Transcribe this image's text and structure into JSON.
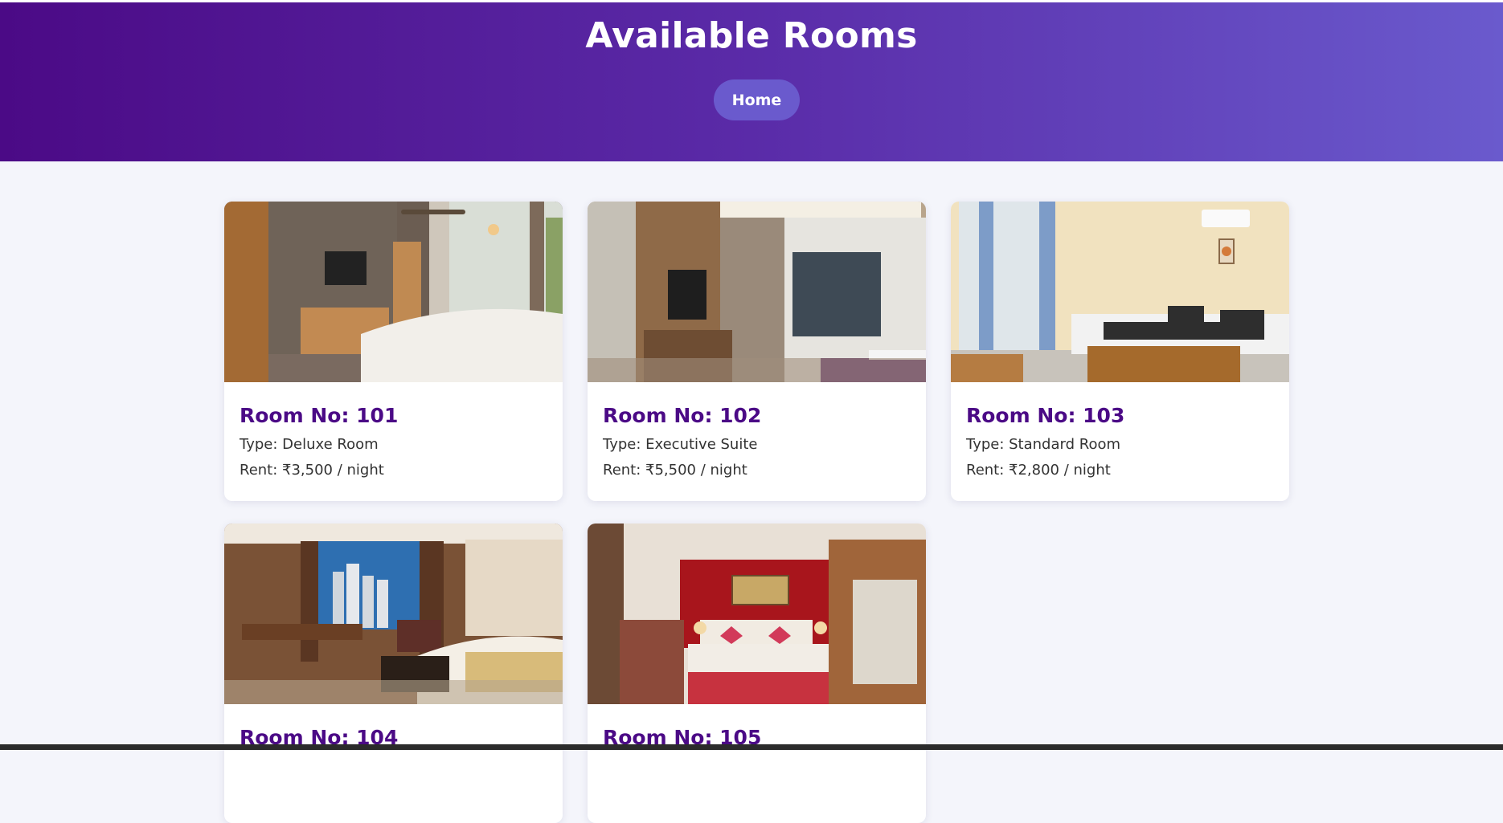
{
  "page": {
    "title": "Available Rooms"
  },
  "nav": {
    "home_label": "Home"
  },
  "colors": {
    "header_start": "#4b0a86",
    "header_end": "#6a5acd",
    "room_number": "#4b0a86",
    "home_button": "#6a5acd"
  },
  "rooms": [
    {
      "number": "Room No: 101",
      "type": "Type: Deluxe Room",
      "rent": "Rent: ₹3,500 / night"
    },
    {
      "number": "Room No: 102",
      "type": "Type: Executive Suite",
      "rent": "Rent: ₹5,500 / night"
    },
    {
      "number": "Room No: 103",
      "type": "Type: Standard Room",
      "rent": "Rent: ₹2,800 / night"
    },
    {
      "number": "Room No: 104"
    },
    {
      "number": "Room No: 105"
    }
  ]
}
